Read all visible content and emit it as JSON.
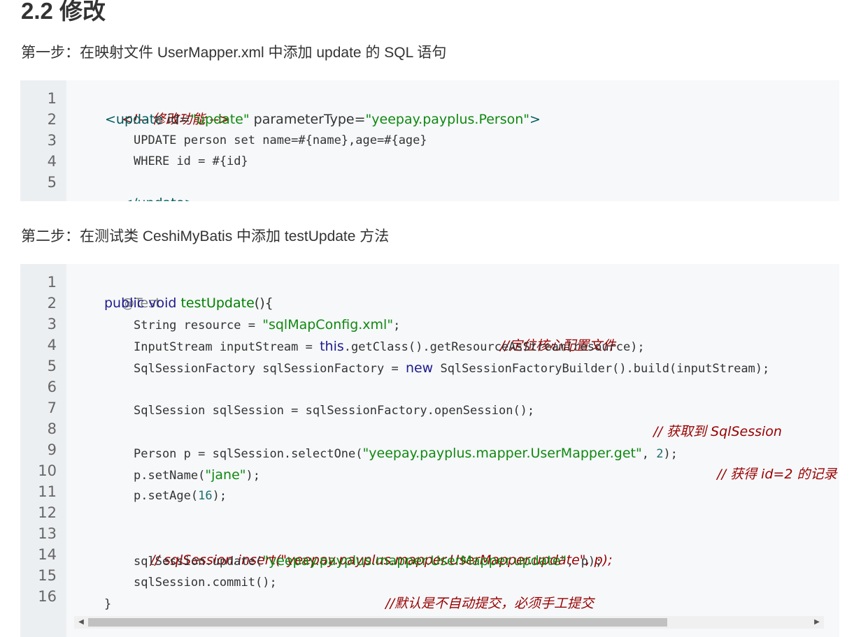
{
  "heading": "2.2 修改",
  "step1": "第一步：在映射文件 UserMapper.xml 中添加 update 的 SQL 语句",
  "step2": "第二步：在测试类 CeshiMyBatis 中添加 testUpdate 方法",
  "block1": {
    "line_numbers": [
      "1",
      "2",
      "3",
      "4",
      "5"
    ],
    "l1_comment": "<!-- 修改功能 -->",
    "l2_open": "<update",
    "l2_id_attr": " id=",
    "l2_id_val": "\"update\"",
    "l2_pt_attr": " parameterType=",
    "l2_pt_val": "\"yeepay.payplus.Person\"",
    "l2_close": ">",
    "l3": "UPDATE person set name=#{name},age=#{age}",
    "l4": "WHERE id = #{id}",
    "l5": "</update>"
  },
  "block2": {
    "line_numbers": [
      "1",
      "2",
      "3",
      "4",
      "5",
      "6",
      "7",
      "8",
      "9",
      "10",
      "11",
      "12",
      "13",
      "14",
      "15",
      "16"
    ],
    "l1": "@Test",
    "l2_kw": "public void",
    "l2_fn": "testUpdate",
    "l2_rest": "(){",
    "l3_a": "String resource = ",
    "l3_str": "\"sqlMapConfig.xml\"",
    "l3_b": ";",
    "l3_cm": "//定位核心配置文件",
    "l4_a": "InputStream inputStream = ",
    "l4_kw": "this",
    "l4_b": ".getClass().getResourceAsStream(resource);",
    "l5_a": "SqlSessionFactory sqlSessionFactory = ",
    "l5_kw": "new",
    "l5_b": " SqlSessionFactoryBuilder().build(inputStream);",
    "l7_a": "SqlSession sqlSession = sqlSessionFactory.openSession();",
    "l7_cm": "// 获取到 SqlSession",
    "l9_a": "Person p = sqlSession.selectOne(",
    "l9_str": "\"yeepay.payplus.mapper.UserMapper.get\"",
    "l9_b": ", ",
    "l9_num": "2",
    "l9_c": ");",
    "l9_cm": "// 获得 id=2 的记录",
    "l10_a": "p.setName(",
    "l10_str": "\"jane\"",
    "l10_b": ");",
    "l11_a": "p.setAge(",
    "l11_num": "16",
    "l11_b": ");",
    "l13_cm": "// sqlSession.insert(\"yeepay.payplus.mapper.UserMapper.update\", p);",
    "l14_a": "sqlSession.update(",
    "l14_str": "\"yeepay.payplus.mapper.UserMapper.update\"",
    "l14_b": ", p);",
    "l15_a": "sqlSession.commit();",
    "l15_cm": "//默认是不自动提交，必须手工提交",
    "l16": "}"
  },
  "scrollbar": {
    "left_arrow": "◀",
    "right_arrow": "▶"
  }
}
